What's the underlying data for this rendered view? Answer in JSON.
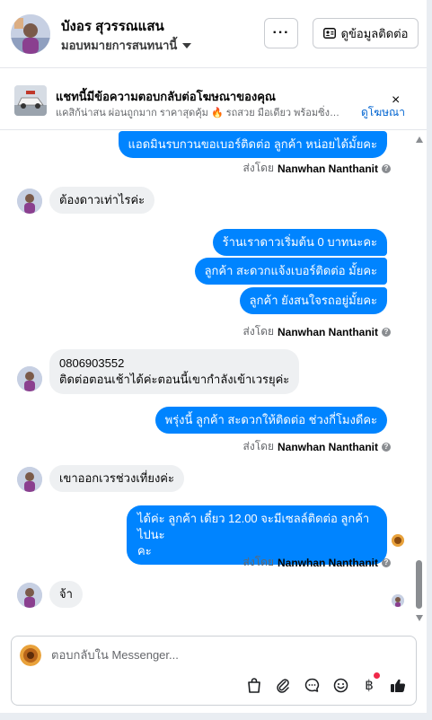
{
  "header": {
    "name": "บังอร สุวรรณแสน",
    "assign_label": "มอบหมายการสนทนานี้",
    "more_label": "···",
    "contact_button": "ดูข้อมูลติดต่อ"
  },
  "ad": {
    "title": "แชทนี้มีข้อความตอบกลับต่อโฆษณาของคุณ",
    "description": "แคสิก้น่าสน ผ่อนถูกมาก ราคาสุดคุ้ม 🔥 รถสวย มือเดียว พร้อมซิ่ง! Nissan",
    "view_link": "ดูโฆษณา",
    "close_label": "×"
  },
  "messages": [
    {
      "dir": "out",
      "text": "แอดมินรบกวนขอเบอร์ติดต่อ ลูกค้า หน่อยได้มั้ยคะ"
    },
    {
      "dir": "sent_by",
      "prefix": "ส่งโดย",
      "sender": "Nanwhan Nanthanit"
    },
    {
      "dir": "in",
      "text": "ต้องดาวเท่าไรค่ะ"
    },
    {
      "dir": "out",
      "text": "ร้านเราดาวเริ่มต้น 0 บาทนะคะ"
    },
    {
      "dir": "out",
      "text": "ลูกค้า สะดวกแจ้งเบอร์ติดต่อ มั้ยคะ"
    },
    {
      "dir": "out",
      "text": "ลูกค้า ยังสนใจรถอยู่มั้ยคะ"
    },
    {
      "dir": "sent_by",
      "prefix": "ส่งโดย",
      "sender": "Nanwhan Nanthanit"
    },
    {
      "dir": "in",
      "line1": "0806903552",
      "line2": "ติดต่อตอนเช้าได้ค่ะตอนนี้เขากำลังเข้าเวรยุค่ะ"
    },
    {
      "dir": "out",
      "text": "พรุ่งนี้ ลูกค้า สะดวกให้ติดต่อ ช่วงกี่โมงดีคะ"
    },
    {
      "dir": "sent_by",
      "prefix": "ส่งโดย",
      "sender": "Nanwhan Nanthanit"
    },
    {
      "dir": "in",
      "text": "เขาออกเวรช่วงเที่ยงค่ะ"
    },
    {
      "dir": "out",
      "line1": "ได้ค่ะ  ลูกค้า  เดี๋ยว 12.00 จะมีเซลล์ติดต่อ ลูกค้า ไปนะ",
      "line2": "คะ"
    },
    {
      "dir": "sent_by",
      "prefix": "ส่งโดย",
      "sender": "Nanwhan Nanthanit"
    },
    {
      "dir": "in",
      "text": "จ้า"
    }
  ],
  "composer": {
    "placeholder": "ตอบกลับใน Messenger..."
  },
  "tools": [
    "bag-icon",
    "paperclip-icon",
    "chat-bubble-icon",
    "smiley-icon",
    "baht-icon",
    "thumbs-up-icon"
  ],
  "colors": {
    "outgoing_bubble": "#0084ff",
    "incoming_bubble": "#eef0f2",
    "link": "#0064d1"
  }
}
